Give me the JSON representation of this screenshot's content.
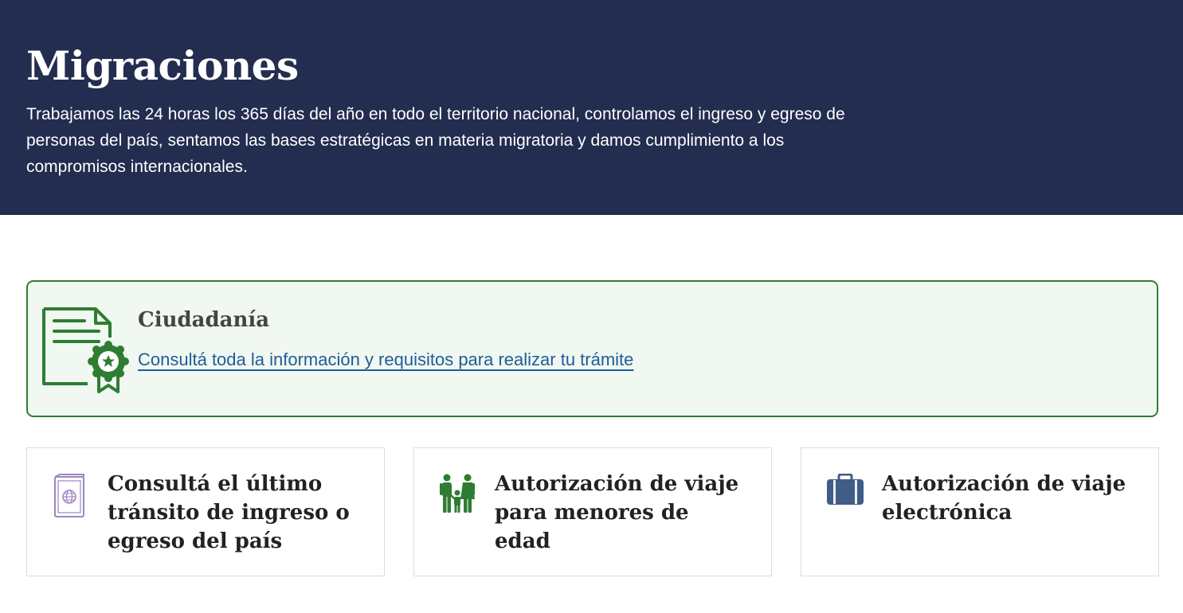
{
  "hero": {
    "title": "Migraciones",
    "description": "Trabajamos las 24 horas los 365 días del año en todo el territorio nacional, controlamos el ingreso y egreso de personas del país, sentamos las bases estratégicas en materia migratoria y damos cumplimiento a los compromisos internacionales.",
    "background_color": "#232d4f"
  },
  "feature": {
    "title": "Ciudadanía",
    "link_text": "Consultá toda la información y requisitos para realizar tu trámite",
    "icon": "certificate-icon",
    "accent_color": "#2e7d32"
  },
  "cards": [
    {
      "title": "Consultá el último tránsito de ingreso o egreso del país",
      "icon": "passport-icon",
      "icon_color": "#9b86c0"
    },
    {
      "title": "Autorización de viaje para menores de edad",
      "icon": "family-icon",
      "icon_color": "#2e7d32"
    },
    {
      "title": "Autorización de viaje electrónica",
      "icon": "briefcase-icon",
      "icon_color": "#3f5d86"
    }
  ]
}
